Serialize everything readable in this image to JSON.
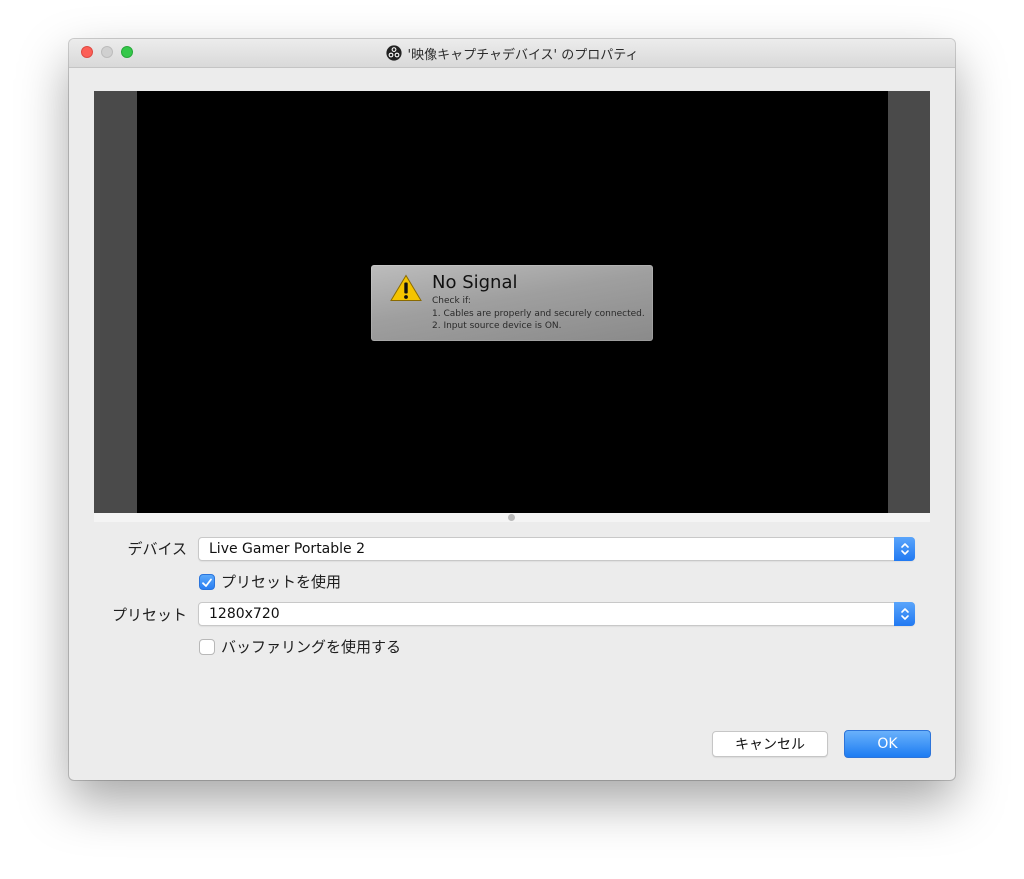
{
  "window": {
    "title": "'映像キャプチャデバイス' のプロパティ",
    "app_icon": "obs-icon"
  },
  "preview": {
    "overlay": {
      "icon": "warning-icon",
      "title": "No Signal",
      "lines": [
        "Check if:",
        "1. Cables are properly and securely connected.",
        "2. Input source device is ON."
      ]
    }
  },
  "form": {
    "device": {
      "label": "デバイス",
      "value": "Live Gamer Portable 2"
    },
    "use_preset": {
      "label": "プリセットを使用",
      "checked": true
    },
    "preset": {
      "label": "プリセット",
      "value": "1280x720"
    },
    "buffering": {
      "label": "バッファリングを使用する",
      "checked": false
    }
  },
  "buttons": {
    "cancel": "キャンセル",
    "ok": "OK"
  },
  "colors": {
    "accent": "#2a7ef2",
    "close": "#fc5f57",
    "maximize": "#35c84a"
  }
}
